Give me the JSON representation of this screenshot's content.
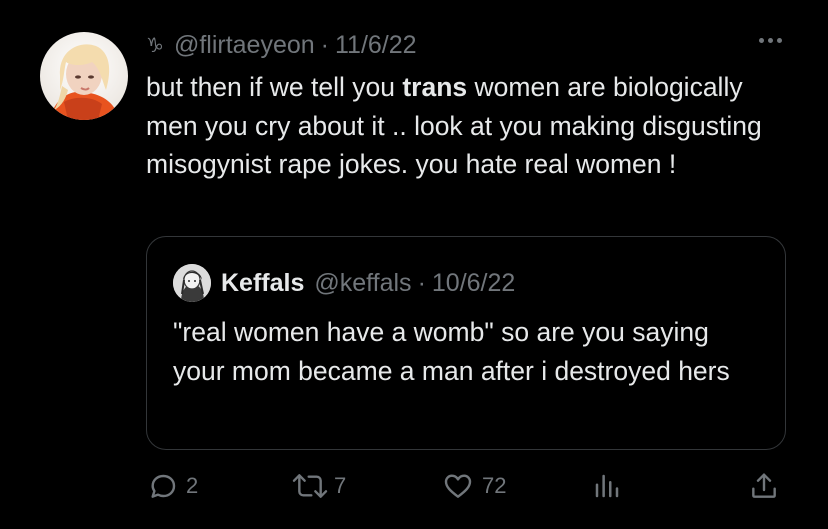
{
  "tweet": {
    "zodiac_glyph": "♑",
    "handle": "@flirtaeyeon",
    "separator": "·",
    "date": "11/6/22",
    "text_before": "but then if we tell you ",
    "text_bold": "trans",
    "text_after": " women are biologically men you cry about it ..  look at you making disgusting misogynist rape jokes. you hate real women !",
    "avatar_icon": "profile-photo"
  },
  "quote": {
    "name": "Keffals",
    "handle": "@keffals",
    "separator": "·",
    "date": "10/6/22",
    "text": "\"real women have a womb\" so are you saying your mom became a man after i destroyed hers",
    "avatar_icon": "profile-photo"
  },
  "actions": {
    "reply_icon": "reply-icon",
    "reply_count": "2",
    "retweet_icon": "retweet-icon",
    "retweet_count": "7",
    "like_icon": "heart-icon",
    "like_count": "72",
    "views_icon": "views-icon",
    "share_icon": "share-icon"
  },
  "colors": {
    "background": "#000000",
    "text": "#e7e9ea",
    "muted": "#71767b",
    "border": "#333639",
    "avatar_accent": "#e8531f"
  }
}
